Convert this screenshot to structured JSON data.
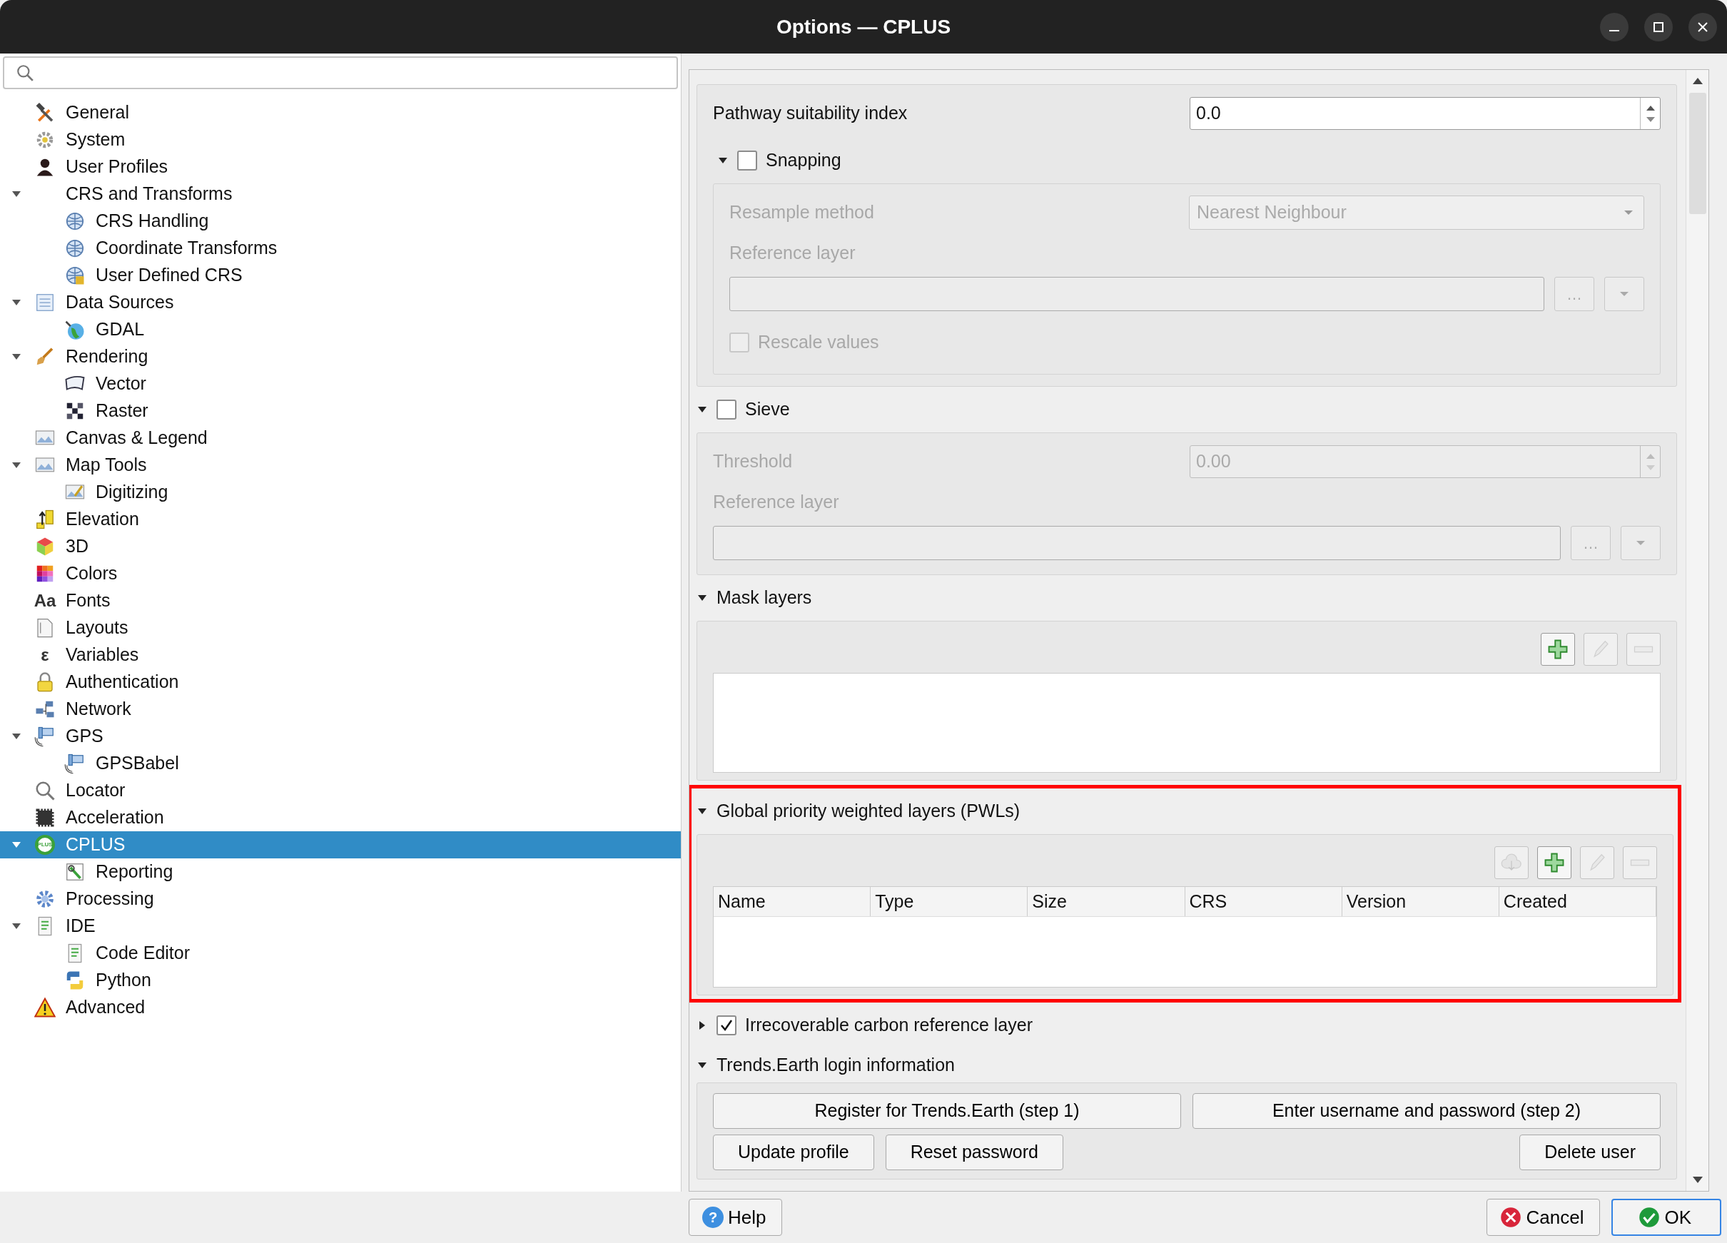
{
  "window": {
    "title": "Options — CPLUS"
  },
  "tree": [
    {
      "label": "General",
      "selected": false
    },
    {
      "label": "System",
      "selected": false
    },
    {
      "label": "User Profiles",
      "selected": false
    },
    {
      "label": "CRS and Transforms",
      "selected": false,
      "expanded": true,
      "children": [
        {
          "label": "CRS Handling",
          "selected": false
        },
        {
          "label": "Coordinate Transforms",
          "selected": false
        },
        {
          "label": "User Defined CRS",
          "selected": false
        }
      ]
    },
    {
      "label": "Data Sources",
      "selected": false,
      "expanded": true,
      "children": [
        {
          "label": "GDAL",
          "selected": false
        }
      ]
    },
    {
      "label": "Rendering",
      "selected": false,
      "expanded": true,
      "children": [
        {
          "label": "Vector",
          "selected": false
        },
        {
          "label": "Raster",
          "selected": false
        }
      ]
    },
    {
      "label": "Canvas & Legend",
      "selected": false
    },
    {
      "label": "Map Tools",
      "selected": false,
      "expanded": true,
      "children": [
        {
          "label": "Digitizing",
          "selected": false
        }
      ]
    },
    {
      "label": "Elevation",
      "selected": false
    },
    {
      "label": "3D",
      "selected": false
    },
    {
      "label": "Colors",
      "selected": false
    },
    {
      "label": "Fonts",
      "selected": false,
      "icon_text": "Aa"
    },
    {
      "label": "Layouts",
      "selected": false
    },
    {
      "label": "Variables",
      "selected": false,
      "icon_text": "ε"
    },
    {
      "label": "Authentication",
      "selected": false
    },
    {
      "label": "Network",
      "selected": false
    },
    {
      "label": "GPS",
      "selected": false,
      "expanded": true,
      "children": [
        {
          "label": "GPSBabel",
          "selected": false
        }
      ]
    },
    {
      "label": "Locator",
      "selected": false
    },
    {
      "label": "Acceleration",
      "selected": false
    },
    {
      "label": "CPLUS",
      "selected": true,
      "icon_text": "PLUS",
      "expanded": true,
      "children": [
        {
          "label": "Reporting",
          "selected": false
        }
      ]
    },
    {
      "label": "Processing",
      "selected": false
    },
    {
      "label": "IDE",
      "selected": false,
      "expanded": true,
      "children": [
        {
          "label": "Code Editor",
          "selected": false
        },
        {
          "label": "Python",
          "selected": false
        }
      ]
    },
    {
      "label": "Advanced",
      "selected": false
    }
  ],
  "settings": {
    "pathway": {
      "label": "Pathway suitability index",
      "value": "0.0"
    },
    "snapping": {
      "label": "Snapping",
      "expanded": true,
      "checked": false,
      "resample_label": "Resample method",
      "resample_value": "Nearest Neighbour",
      "reference_label": "Reference layer",
      "browse": "…",
      "rescale": {
        "label": "Rescale values",
        "checked": false
      }
    },
    "sieve": {
      "label": "Sieve",
      "expanded": true,
      "checked": false,
      "threshold_label": "Threshold",
      "threshold_value": "0.00",
      "reference_label": "Reference layer",
      "browse": "…"
    },
    "mask_layers": {
      "label": "Mask layers",
      "expanded": true,
      "tools": [
        {
          "kind": "add",
          "disabled": false
        },
        {
          "kind": "edit",
          "disabled": true
        },
        {
          "kind": "remove",
          "disabled": true
        }
      ]
    },
    "pwl": {
      "label": "Global priority weighted layers (PWLs)",
      "expanded": true,
      "highlighted": true,
      "tools": [
        {
          "kind": "download",
          "disabled": true
        },
        {
          "kind": "add",
          "disabled": false
        },
        {
          "kind": "edit",
          "disabled": true
        },
        {
          "kind": "remove",
          "disabled": true
        }
      ],
      "columns": [
        "Name",
        "Type",
        "Size",
        "CRS",
        "Version",
        "Created"
      ]
    },
    "irrecoverable": {
      "label": "Irrecoverable carbon reference layer",
      "expanded": false,
      "checked": true
    },
    "trends": {
      "label": "Trends.Earth login information",
      "expanded": true,
      "buttons": [
        [
          "Register for Trends.Earth (step 1)",
          "Enter username and password (step 2)"
        ],
        [
          "Update profile",
          "Reset password",
          "Delete user"
        ]
      ]
    }
  },
  "footer": {
    "help": {
      "label": "Help",
      "icon_text": "?"
    },
    "cancel": {
      "label": "Cancel"
    },
    "ok": {
      "label": "OK"
    }
  }
}
